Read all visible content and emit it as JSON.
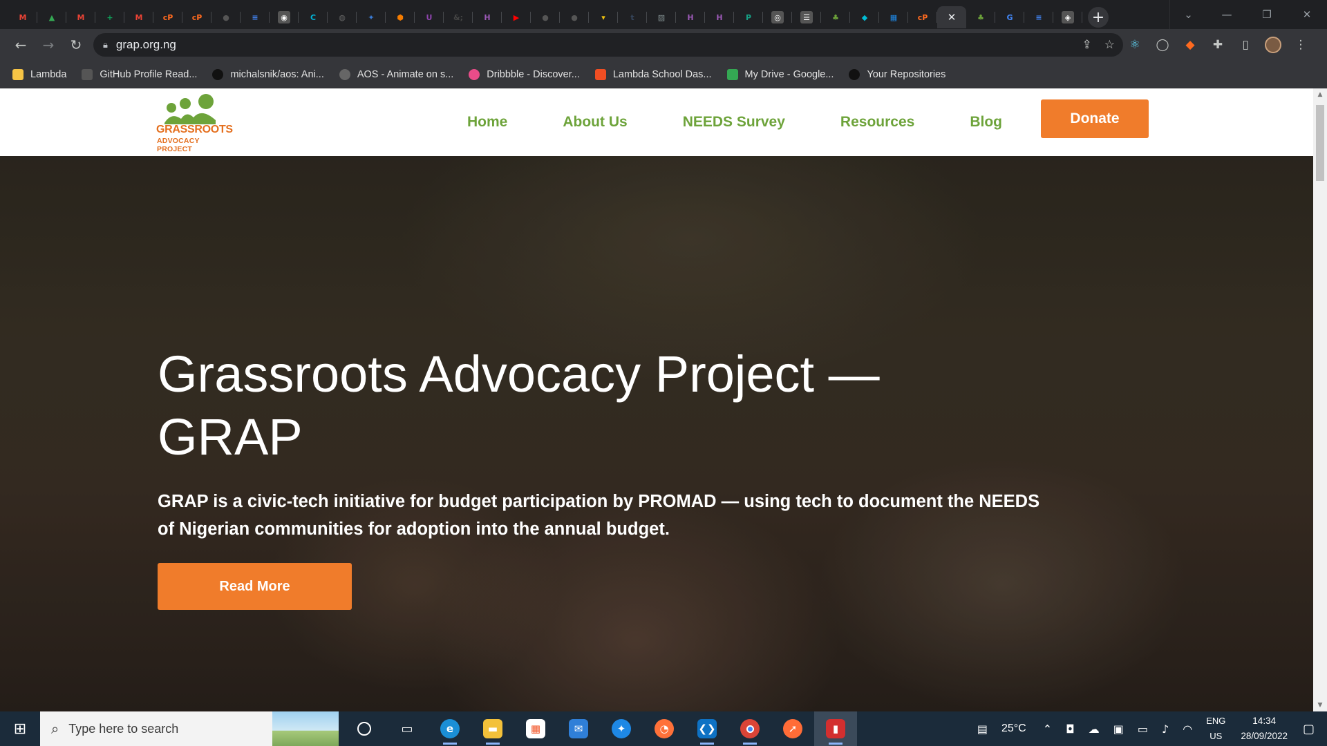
{
  "browser": {
    "tabs": [
      {
        "icon": "gmail-icon",
        "glyph": "M",
        "color": "#ea4335"
      },
      {
        "icon": "google-drive-icon",
        "glyph": "▲",
        "color": "#34a853"
      },
      {
        "icon": "gmail-icon",
        "glyph": "M",
        "color": "#ea4335"
      },
      {
        "icon": "google-sheets-icon",
        "glyph": "+",
        "color": "#0f9d58"
      },
      {
        "icon": "gmail-icon",
        "glyph": "M",
        "color": "#ea4335"
      },
      {
        "icon": "codepen-icon",
        "glyph": "cP",
        "color": "#ff6a1f"
      },
      {
        "icon": "codepen-icon",
        "glyph": "cP",
        "color": "#ff6a1f"
      },
      {
        "icon": "github-icon",
        "glyph": "●",
        "color": "#555"
      },
      {
        "icon": "docs-icon",
        "glyph": "≡",
        "color": "#4285f4"
      },
      {
        "icon": "app-icon",
        "glyph": "◉",
        "color": "#ffffff"
      },
      {
        "icon": "c-logo-icon",
        "glyph": "C",
        "color": "#00b4d8"
      },
      {
        "icon": "globe-icon",
        "glyph": "◍",
        "color": "#666"
      },
      {
        "icon": "app-icon",
        "glyph": "✦",
        "color": "#3a7bd5"
      },
      {
        "icon": "hex-icon",
        "glyph": "⬢",
        "color": "#f57c00"
      },
      {
        "icon": "app-icon",
        "glyph": "U",
        "color": "#8e44ad"
      },
      {
        "icon": "ampersand-icon",
        "glyph": "&;",
        "color": "#444"
      },
      {
        "icon": "h-icon",
        "glyph": "H",
        "color": "#9b59b6"
      },
      {
        "icon": "youtube-icon",
        "glyph": "▶",
        "color": "#ff0000"
      },
      {
        "icon": "github-icon",
        "glyph": "●",
        "color": "#555"
      },
      {
        "icon": "github-icon",
        "glyph": "●",
        "color": "#555"
      },
      {
        "icon": "app-icon",
        "glyph": "▾",
        "color": "#f1c40f"
      },
      {
        "icon": "tumblr-icon",
        "glyph": "t",
        "color": "#36465d"
      },
      {
        "icon": "image-icon",
        "glyph": "▨",
        "color": "#7f8c8d"
      },
      {
        "icon": "h-icon",
        "glyph": "H",
        "color": "#9b59b6"
      },
      {
        "icon": "h-icon",
        "glyph": "H",
        "color": "#9b59b6"
      },
      {
        "icon": "app-icon",
        "glyph": "P",
        "color": "#16a085"
      },
      {
        "icon": "app-icon",
        "glyph": "◎",
        "color": "#ffffff"
      },
      {
        "icon": "article-icon",
        "glyph": "☰",
        "color": "#ffffff"
      },
      {
        "icon": "grassroots-icon",
        "glyph": "♣",
        "color": "#6da33a"
      },
      {
        "icon": "app-icon",
        "glyph": "◆",
        "color": "#00bcd4"
      },
      {
        "icon": "grid-icon",
        "glyph": "▦",
        "color": "#1e88e5"
      },
      {
        "icon": "codepen-icon",
        "glyph": "cP",
        "color": "#ff6a1f"
      }
    ],
    "active_tab_close": "✕",
    "after_tabs": [
      {
        "icon": "grassroots-icon",
        "glyph": "♣",
        "color": "#6da33a"
      },
      {
        "icon": "google-icon",
        "glyph": "G",
        "color": "#4285f4"
      },
      {
        "icon": "docs-icon",
        "glyph": "≡",
        "color": "#4285f4"
      },
      {
        "icon": "app-icon",
        "glyph": "◈",
        "color": "#ffffff"
      }
    ],
    "url": "grap.org.ng",
    "bookmarks": [
      {
        "label": "Lambda",
        "icon": "folder-icon",
        "color": "#f6c445"
      },
      {
        "label": "GitHub Profile Read...",
        "icon": "mg-icon",
        "color": "#555"
      },
      {
        "label": "michalsnik/aos: Ani...",
        "icon": "github-icon",
        "color": "#111"
      },
      {
        "label": "AOS - Animate on s...",
        "icon": "globe-icon",
        "color": "#666"
      },
      {
        "label": "Dribbble - Discover...",
        "icon": "dribbble-icon",
        "color": "#ea4c89"
      },
      {
        "label": "Lambda School Das...",
        "icon": "lambda-icon",
        "color": "#f04e23"
      },
      {
        "label": "My Drive - Google...",
        "icon": "google-drive-icon",
        "color": "#34a853"
      },
      {
        "label": "Your Repositories",
        "icon": "github-icon",
        "color": "#111"
      }
    ]
  },
  "site": {
    "logo_line1": "GRASSROOTS",
    "logo_line2": "ADVOCACY PROJECT",
    "nav": [
      "Home",
      "About Us",
      "NEEDS Survey",
      "Resources",
      "Blog"
    ],
    "donate_label": "Donate",
    "hero_title": "Grassroots Advocacy Project — GRAP",
    "hero_text": "GRAP is a civic-tech initiative for budget participation by PROMAD — using tech to document the NEEDS of Nigerian communities for adoption into the annual budget.",
    "read_more_label": "Read More"
  },
  "taskbar": {
    "search_placeholder": "Type here to search",
    "temperature": "25°C",
    "lang1": "ENG",
    "lang2": "US",
    "time": "14:34",
    "date": "28/09/2022"
  },
  "colors": {
    "accent_orange": "#f07c2b",
    "nav_green": "#6da33a",
    "logo_orange": "#e46f1e"
  }
}
